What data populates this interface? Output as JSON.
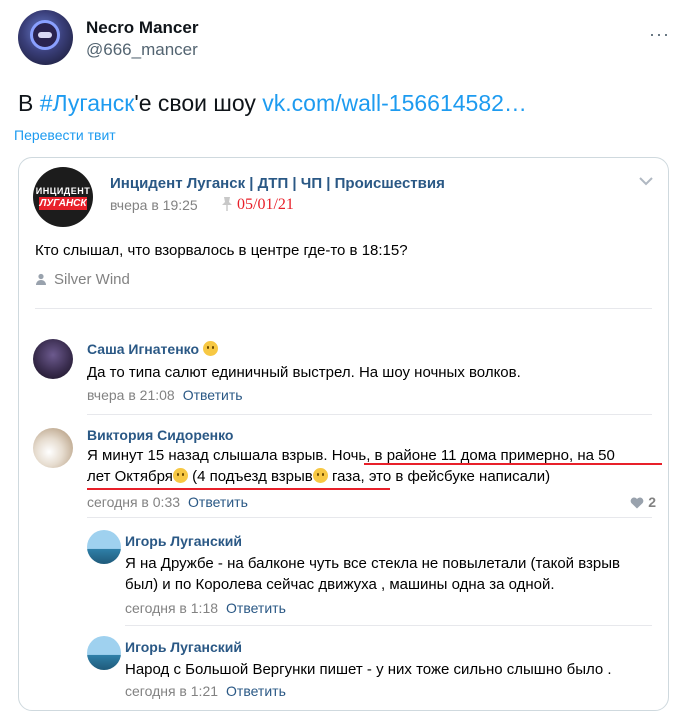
{
  "tweet": {
    "display_name": "Necro Mancer",
    "handle": "@666_mancer",
    "more_icon": "more-dots-icon",
    "text_prefix": "В ",
    "hashtag": "#Луганск",
    "text_middle": "'е свои шоу ",
    "link": "vk.com/wall-156614582…",
    "translate_label": "Перевести твит"
  },
  "vk_post": {
    "avatar_line1": "ИНЦИДЕНТ",
    "avatar_line2": "ЛУГАНСК",
    "group_name": "Инцидент Луганск | ДТП | ЧП | Происшествия",
    "time": "вчера в 19:25",
    "date_stamp": "05/01/21",
    "text": "Кто слышал, что взорвалось в центре где-то в 18:15?",
    "signer": "Silver Wind"
  },
  "comments": [
    {
      "name": "Саша Игнатенко",
      "text": "Да то типа салют единичный выстрел. На шоу ночных волков.",
      "time": "вчера в 21:08",
      "reply": "Ответить"
    },
    {
      "name": "Виктория Сидоренко",
      "line1_a": "Я минут 15 назад слышала взрыв. ",
      "line1_b": "Ночь, в районе 11 дома примерно, на 50",
      "line2_a": "лет Октября",
      "line2_b": " (4 подъезд взрыв",
      "line2_c": " газа, это в фейсбуке написали)",
      "time": "сегодня в 0:33",
      "reply": "Ответить",
      "likes": "2"
    }
  ],
  "replies": [
    {
      "name": "Игорь Луганский",
      "line1": "Я на Дружбе - на балконе чуть все стекла не повылетали (такой взрыв",
      "line2": "был) и по Королева сейчас движуха , машины одна за одной.",
      "time": "сегодня в 1:18",
      "reply": "Ответить"
    },
    {
      "name": "Игорь Луганский",
      "line1": "Народ с Большой Вергунки пишет - у них тоже сильно слышно было .",
      "time": "сегодня в 1:21",
      "reply": "Ответить"
    }
  ],
  "colors": {
    "twitter_link": "#1d9bf0",
    "vk_link": "#2a5885",
    "stamp_red": "#e8202a"
  }
}
